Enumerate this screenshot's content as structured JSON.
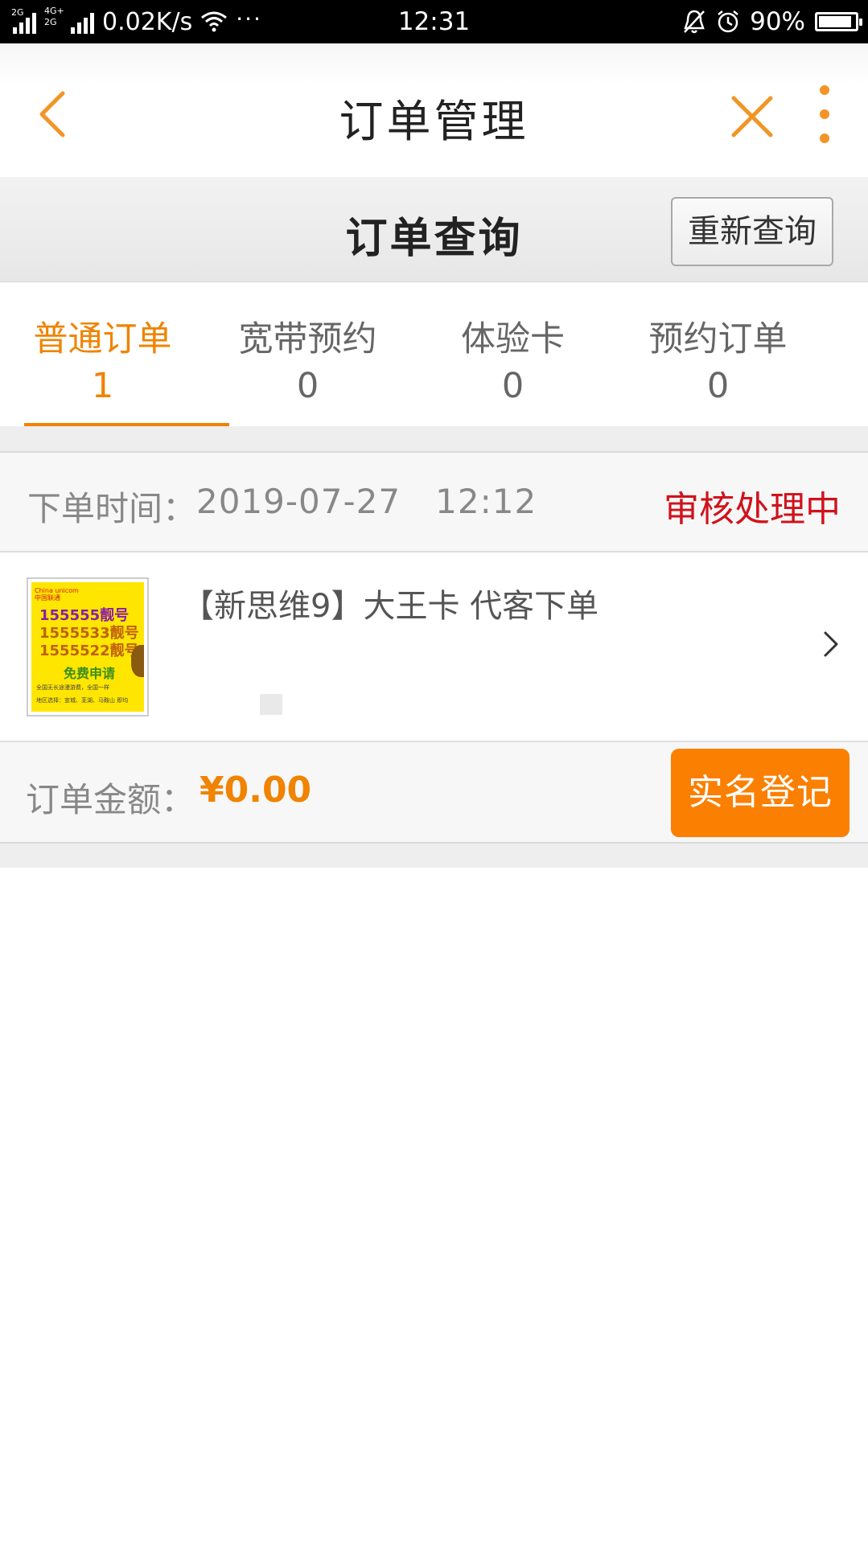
{
  "status_bar": {
    "network_top": "2G",
    "network_mid": "4G+",
    "network_bot": "2G",
    "speed": "0.02K/s",
    "more": "···",
    "time": "12:31",
    "battery": "90%",
    "battery_level": 0.9
  },
  "header": {
    "title": "订单管理"
  },
  "query": {
    "title": "订单查询",
    "requery_label": "重新查询"
  },
  "tabs": [
    {
      "label": "普通订单",
      "count": "1",
      "active": true
    },
    {
      "label": "宽带预约",
      "count": "0",
      "active": false
    },
    {
      "label": "体验卡",
      "count": "0",
      "active": false
    },
    {
      "label": "预约订单",
      "count": "0",
      "active": false
    }
  ],
  "order": {
    "time_label": "下单时间：",
    "time_value": "2019-07-27   12:12",
    "status": "审核处理中",
    "item_title": "【新思维9】大王卡 代客下单",
    "thumb": {
      "brand": "China unicom中国联通",
      "line1": "155555靓号",
      "line2": "1555533靓号",
      "line3": "1555522靓号",
      "free": "免费申请",
      "note1": "全国无长途漫游费，全国一样",
      "note2": "地区选择：宣城、芜湖、马鞍山 即均"
    },
    "amount_label": "订单金额：",
    "amount_value": "¥0.00",
    "register_label": "实名登记"
  },
  "colors": {
    "accent": "#f08300",
    "status_red": "#d0121b",
    "button_orange": "#fb7f00"
  }
}
